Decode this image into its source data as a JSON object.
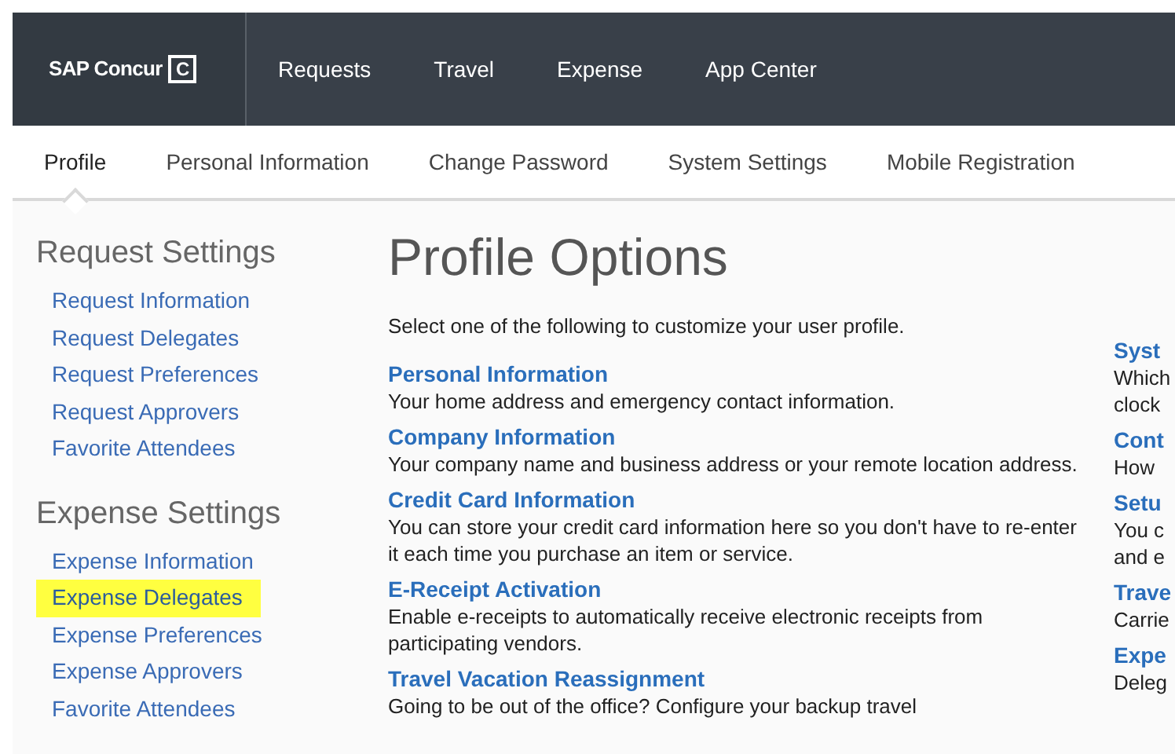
{
  "brand": {
    "name": "SAP Concur",
    "mark": "C"
  },
  "top_nav": [
    {
      "label": "Requests"
    },
    {
      "label": "Travel"
    },
    {
      "label": "Expense"
    },
    {
      "label": "App Center"
    }
  ],
  "tabs": [
    {
      "label": "Profile",
      "selected": true
    },
    {
      "label": "Personal Information",
      "selected": false
    },
    {
      "label": "Change Password",
      "selected": false
    },
    {
      "label": "System Settings",
      "selected": false
    },
    {
      "label": "Mobile Registration",
      "selected": false
    }
  ],
  "sidebar": [
    {
      "heading": "Request Settings",
      "items": [
        {
          "label": "Request Information",
          "highlighted": false
        },
        {
          "label": "Request Delegates",
          "highlighted": false
        },
        {
          "label": "Request Preferences",
          "highlighted": false
        },
        {
          "label": "Request Approvers",
          "highlighted": false
        },
        {
          "label": "Favorite Attendees",
          "highlighted": false
        }
      ]
    },
    {
      "heading": "Expense Settings",
      "items": [
        {
          "label": "Expense Information",
          "highlighted": false
        },
        {
          "label": "Expense Delegates",
          "highlighted": true
        },
        {
          "label": "Expense Preferences",
          "highlighted": false
        },
        {
          "label": "Expense Approvers",
          "highlighted": false
        },
        {
          "label": "Favorite Attendees",
          "highlighted": false
        }
      ]
    }
  ],
  "page_title": "Profile Options",
  "intro": "Select one of the following to customize your user profile.",
  "options": [
    {
      "title": "Personal Information",
      "description": "Your home address and emergency contact information."
    },
    {
      "title": "Company Information",
      "description": "Your company name and business address or your remote location address."
    },
    {
      "title": "Credit Card Information",
      "description": "You can store your credit card information here so you don't have to re-enter it each time you purchase an item or service."
    },
    {
      "title": "E-Receipt Activation",
      "description": "Enable e-receipts to automatically receive electronic receipts from participating vendors."
    },
    {
      "title": "Travel Vacation Reassignment",
      "description": "Going to be out of the office? Configure your backup travel"
    }
  ],
  "options_column_2": [
    {
      "title": "Syst",
      "lines": [
        "Which",
        "clock"
      ]
    },
    {
      "title": "Cont",
      "lines": [
        "How"
      ]
    },
    {
      "title": "Setu",
      "lines": [
        "You c",
        "and e"
      ]
    },
    {
      "title": "Trave",
      "lines": [
        "Carrie"
      ]
    },
    {
      "title": "Expe",
      "lines": [
        "Deleg"
      ]
    }
  ]
}
